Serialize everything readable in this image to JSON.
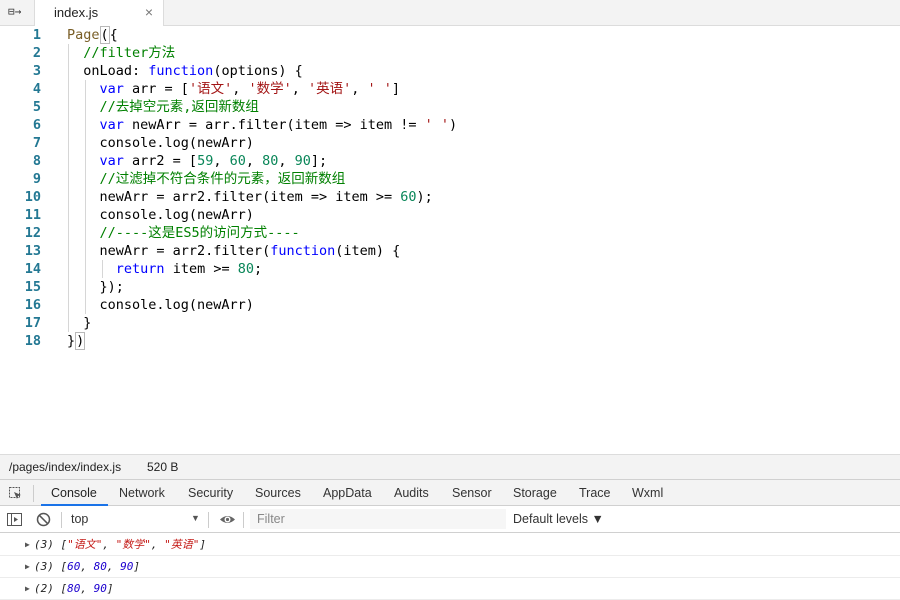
{
  "editor_tab": {
    "filename": "index.js",
    "close_glyph": "×"
  },
  "code": {
    "line_numbers": [
      "1",
      "2",
      "3",
      "4",
      "5",
      "6",
      "7",
      "8",
      "9",
      "10",
      "11",
      "12",
      "13",
      "14",
      "15",
      "16",
      "17",
      "18"
    ]
  },
  "status": {
    "path": "/pages/index/index.js",
    "size": "520 B"
  },
  "devtools_tabs": [
    "Console",
    "Network",
    "Security",
    "Sources",
    "AppData",
    "Audits",
    "Sensor",
    "Storage",
    "Trace",
    "Wxml"
  ],
  "console_toolbar": {
    "context": "top",
    "filter_placeholder": "Filter",
    "levels": "Default levels ▼"
  },
  "console_messages": [
    {
      "count": "(3)",
      "items": [
        "\"语文\"",
        "\"数学\"",
        "\"英语\""
      ],
      "kind": "string"
    },
    {
      "count": "(3)",
      "items": [
        "60",
        "80",
        "90"
      ],
      "kind": "number"
    },
    {
      "count": "(2)",
      "items": [
        "80",
        "90"
      ],
      "kind": "number"
    }
  ],
  "colors": {
    "accent": "#1a73e8",
    "keyword": "#0000ff",
    "string": "#a31515",
    "number": "#098658",
    "comment": "#008000",
    "line_number": "#237893"
  }
}
